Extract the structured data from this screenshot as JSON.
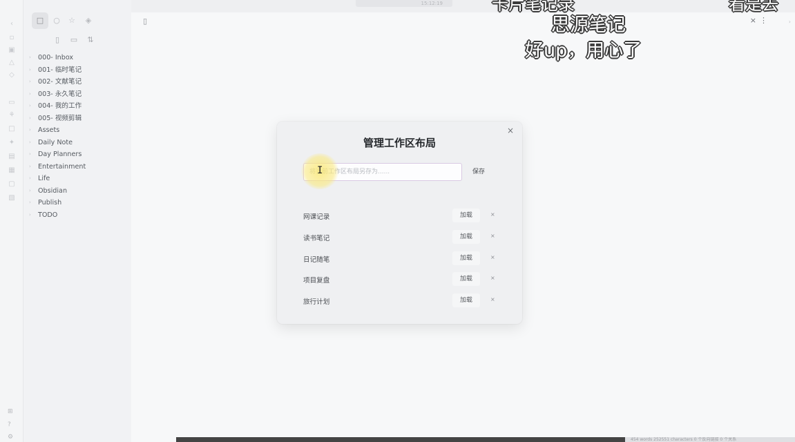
{
  "ribbon": {
    "icons": [
      "chevron-left-icon",
      "files-icon",
      "calendar-icon",
      "graph-icon",
      "command-icon",
      "template-icon",
      "audio-icon",
      "canvas-icon",
      "publish-icon",
      "kanban-icon",
      "random-icon",
      "vault-icon",
      "help-icon",
      "settings-icon"
    ]
  },
  "sidebar": {
    "tabs": [
      "file-explorer-icon",
      "search-icon",
      "starred-icon",
      "tag-icon"
    ],
    "actions": [
      "new-note-icon",
      "new-folder-icon",
      "sort-icon"
    ],
    "items": [
      {
        "label": "000- Inbox"
      },
      {
        "label": "001- 临时笔记"
      },
      {
        "label": "002- 文献笔记"
      },
      {
        "label": "003- 永久笔记"
      },
      {
        "label": "004- 我的工作"
      },
      {
        "label": "005- 视频剪辑"
      },
      {
        "label": "Assets"
      },
      {
        "label": "Daily Note"
      },
      {
        "label": "Day Planners"
      },
      {
        "label": "Entertainment"
      },
      {
        "label": "Life"
      },
      {
        "label": "Obsidian"
      },
      {
        "label": "Publish"
      },
      {
        "label": "TODO"
      }
    ]
  },
  "captions": {
    "top_left": "卡片笔记录",
    "top_right": "看是去",
    "line1": "思源笔记",
    "line2": "好up，用心了"
  },
  "topbar": {
    "time": "15:12:19"
  },
  "modal": {
    "title": "管理工作区布局",
    "input_placeholder": "将当前工作区布局另存为......",
    "save_label": "保存",
    "load_label": "加载",
    "delete_symbol": "×",
    "layouts": [
      {
        "name": "网课记录"
      },
      {
        "name": "读书笔记"
      },
      {
        "name": "日记随笔"
      },
      {
        "name": "项目复盘"
      },
      {
        "name": "旅行计划"
      }
    ]
  },
  "status": {
    "text": "454 words 252551 characters   0 个反向链接   0 个关系"
  }
}
